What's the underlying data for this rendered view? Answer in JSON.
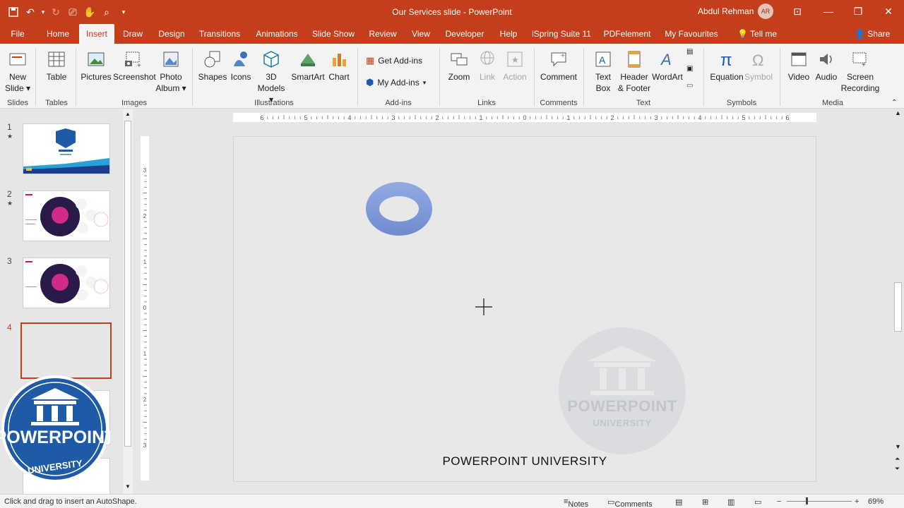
{
  "window": {
    "title": "Our Services slide  -  PowerPoint",
    "user_name": "Abdul Rehman",
    "avatar_initials": "AR"
  },
  "tabs": [
    "File",
    "Home",
    "Insert",
    "Draw",
    "Design",
    "Transitions",
    "Animations",
    "Slide Show",
    "Review",
    "View",
    "Developer",
    "Help",
    "iSpring Suite 11",
    "PDFelement",
    "My Favourites"
  ],
  "tell_me": "Tell me",
  "share": "Share",
  "ribbon": {
    "new_slide": "New Slide",
    "table": "Table",
    "pictures": "Pictures",
    "screenshot": "Screenshot",
    "photo_album": "Photo Album",
    "shapes": "Shapes",
    "icons": "Icons",
    "models_3d": "3D Models",
    "smartart": "SmartArt",
    "chart": "Chart",
    "get_addins": "Get Add-ins",
    "my_addins": "My Add-ins",
    "zoom": "Zoom",
    "link": "Link",
    "action": "Action",
    "comment": "Comment",
    "text_box": "Text Box",
    "header_footer": "Header & Footer",
    "wordart": "WordArt",
    "equation": "Equation",
    "symbol": "Symbol",
    "video": "Video",
    "audio": "Audio",
    "screen_recording": "Screen Recording",
    "groups": {
      "slides": "Slides",
      "tables": "Tables",
      "images": "Images",
      "illustrations": "Illustrations",
      "addins": "Add-ins",
      "links": "Links",
      "comments": "Comments",
      "text": "Text",
      "symbols": "Symbols",
      "media": "Media"
    }
  },
  "slides": [
    {
      "number": "1",
      "star": "★"
    },
    {
      "number": "2",
      "star": "★"
    },
    {
      "number": "3",
      "star": ""
    },
    {
      "number": "4",
      "star": ""
    }
  ],
  "slide": {
    "footer": "POWERPOINT UNIVERSITY"
  },
  "watermark": {
    "line1": "POWERPOINT",
    "line2": "UNIVERSITY"
  },
  "ruler": {
    "h_labels": [
      "6",
      "5",
      "4",
      "3",
      "2",
      "1",
      "0",
      "1",
      "2",
      "3",
      "4",
      "5",
      "6"
    ],
    "v_labels": [
      "3",
      "2",
      "1",
      "0",
      "1",
      "2",
      "3"
    ]
  },
  "status": {
    "message": "Click and drag to insert an AutoShape.",
    "notes": "Notes",
    "comments": "Comments",
    "zoom": "69%"
  },
  "colors": {
    "accent": "#c43e1c",
    "donut": "#7f9ad8",
    "logo_blue": "#1f5aa6"
  }
}
